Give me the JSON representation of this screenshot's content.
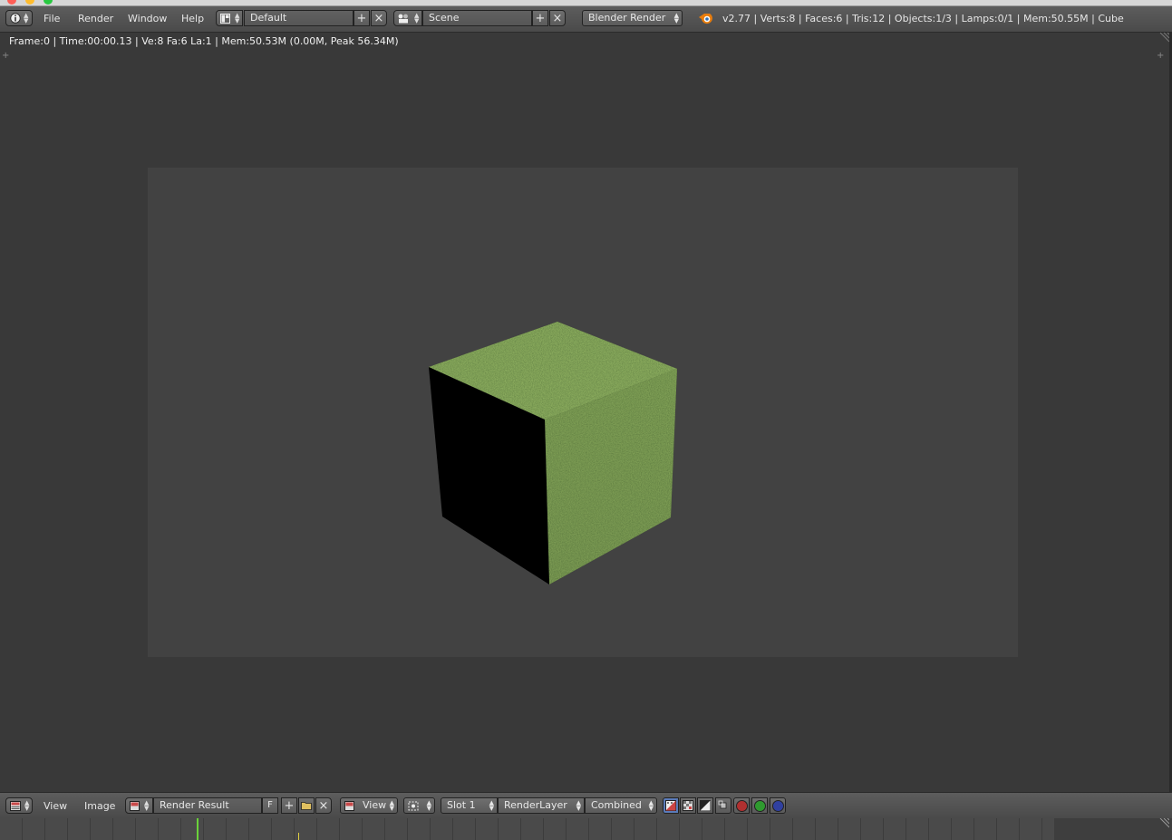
{
  "window": {
    "traffic_colors": [
      "#ff5f57",
      "#febc2e",
      "#28c840"
    ]
  },
  "header": {
    "menus": [
      "File",
      "Render",
      "Window",
      "Help"
    ],
    "layout_name": "Default",
    "scene_name": "Scene",
    "render_engine": "Blender Render",
    "stats": "v2.77 | Verts:8 | Faces:6 | Tris:12 | Objects:1/3 | Lamps:0/1 | Mem:50.55M | Cube"
  },
  "render_info": {
    "text": "Frame:0 | Time:00:00.13 | Ve:8 Fa:6 La:1 | Mem:50.53M (0.00M, Peak 56.34M)"
  },
  "image_editor": {
    "menus": [
      "View",
      "Image"
    ],
    "image_name": "Render Result",
    "fake_user_label": "F",
    "view_mode": "View",
    "slot": "Slot 1",
    "render_layer": "RenderLayer",
    "pass": "Combined"
  },
  "icons": {
    "info": "info-icon",
    "layout": "screen-layout-icon",
    "scene": "scene-icon",
    "blender_logo": "blender-logo-icon",
    "editor_type": "image-editor-icon",
    "image_browse": "image-browse-icon",
    "view_mode": "image-view-icon",
    "pivot": "pivot-icon"
  },
  "colors": {
    "header_bg": "#555555",
    "viewport_bg": "#393939",
    "canvas_bg": "#424242",
    "grass_dark": "#2f4a1c",
    "grass_light": "#5c7a34",
    "channel_red": "#b03030",
    "channel_green": "#2f9a2f",
    "channel_blue": "#3040a0",
    "frame_marker": "#6ad23a"
  }
}
